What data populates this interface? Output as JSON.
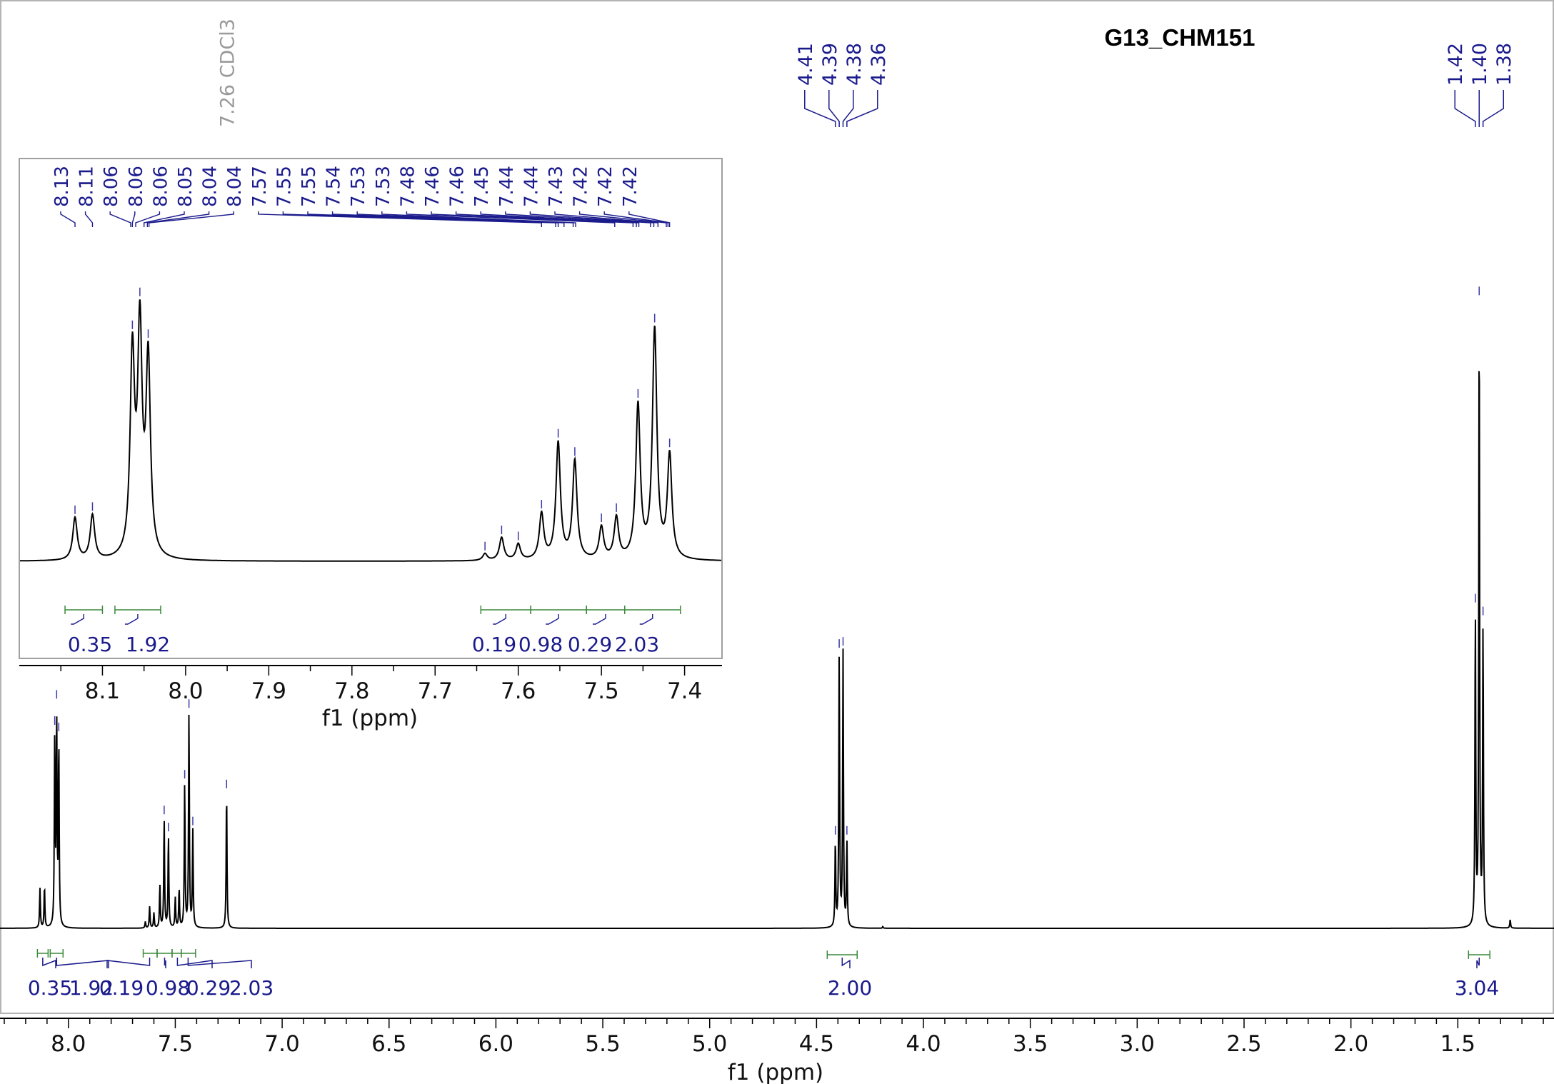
{
  "chart_data": [
    {
      "type": "line",
      "title": "G13_CHM151",
      "xlabel": "f1 (ppm)",
      "xlim": [
        8.32,
        1.05
      ],
      "x_reversed": true,
      "x_ticks": [
        8.0,
        7.5,
        7.0,
        6.5,
        6.0,
        5.5,
        5.0,
        4.5,
        4.0,
        3.5,
        3.0,
        2.5,
        2.0,
        1.5
      ],
      "tick_labels": [
        "8.0",
        "7.5",
        "7.0",
        "6.5",
        "6.0",
        "5.5",
        "5.0",
        "4.5",
        "4.0",
        "3.5",
        "3.0",
        "2.5",
        "2.0",
        "1.5"
      ],
      "peaks": [
        {
          "x": 8.133,
          "y": 0.185
        },
        {
          "x": 8.112,
          "y": 0.195
        },
        {
          "x": 8.064,
          "y": 0.87
        },
        {
          "x": 8.055,
          "y": 0.97
        },
        {
          "x": 8.045,
          "y": 0.85
        },
        {
          "x": 7.64,
          "y": 0.03
        },
        {
          "x": 7.62,
          "y": 0.1
        },
        {
          "x": 7.6,
          "y": 0.07
        },
        {
          "x": 7.572,
          "y": 0.2
        },
        {
          "x": 7.552,
          "y": 0.51
        },
        {
          "x": 7.532,
          "y": 0.43
        },
        {
          "x": 7.5,
          "y": 0.14
        },
        {
          "x": 7.482,
          "y": 0.18
        },
        {
          "x": 7.456,
          "y": 0.67
        },
        {
          "x": 7.436,
          "y": 1.0
        },
        {
          "x": 7.418,
          "y": 0.45
        },
        {
          "x": 7.26,
          "y": 0.64
        },
        {
          "x": 4.412,
          "y": 0.4
        },
        {
          "x": 4.394,
          "y": 1.27
        },
        {
          "x": 4.376,
          "y": 1.28
        },
        {
          "x": 4.358,
          "y": 0.4
        },
        {
          "x": 4.19,
          "y": 0.008
        },
        {
          "x": 1.418,
          "y": 1.46
        },
        {
          "x": 1.4,
          "y": 2.9
        },
        {
          "x": 1.382,
          "y": 1.4
        },
        {
          "x": 1.255,
          "y": 0.04
        }
      ],
      "peak_labels": {
        "group1": [
          "4.41",
          "4.39",
          "4.38",
          "4.36"
        ],
        "group2": [
          "1.42",
          "1.40",
          "1.38"
        ],
        "solvent": "7.26 CDCl3"
      },
      "integrals": [
        "0.35",
        "1.92",
        "0.19",
        "0.98",
        "0.29",
        "2.03",
        "2.00",
        "3.04"
      ]
    },
    {
      "type": "line",
      "title": "",
      "xlabel": "f1 (ppm)",
      "xlim": [
        8.2,
        7.355
      ],
      "x_reversed": true,
      "x_ticks": [
        8.1,
        8.0,
        7.9,
        7.8,
        7.7,
        7.6,
        7.5,
        7.4
      ],
      "tick_labels": [
        "8.1",
        "8.0",
        "7.9",
        "7.8",
        "7.7",
        "7.6",
        "7.5",
        "7.4"
      ],
      "peak_labels": [
        "8.13",
        "8.11",
        "8.06",
        "8.06",
        "8.06",
        "8.05",
        "8.04",
        "8.04",
        "7.57",
        "7.55",
        "7.55",
        "7.54",
        "7.53",
        "7.53",
        "7.48",
        "7.46",
        "7.46",
        "7.45",
        "7.44",
        "7.44",
        "7.43",
        "7.42",
        "7.42",
        "7.42"
      ],
      "integrals": [
        "0.35",
        "1.92",
        "0.19",
        "0.98",
        "0.29",
        "2.03"
      ]
    }
  ]
}
